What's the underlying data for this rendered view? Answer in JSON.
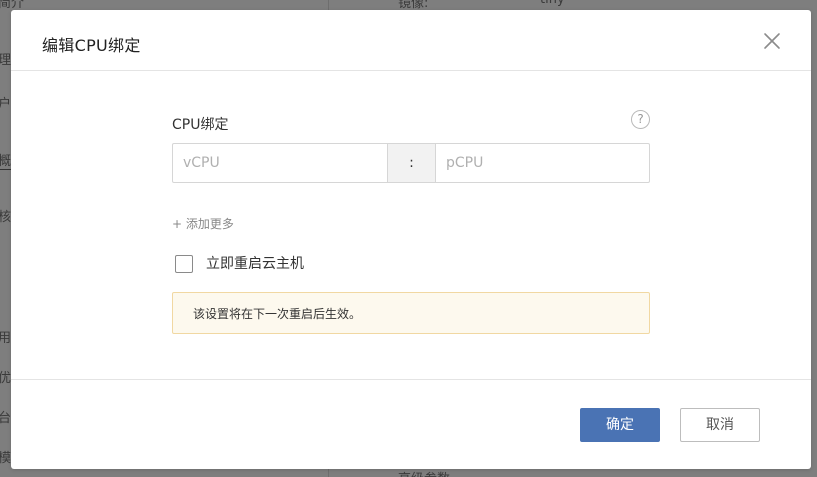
{
  "background": {
    "top_left": "简介",
    "top_right_label": "镜像:",
    "top_right_value": "tiny",
    "sidebar_items": [
      "理",
      "户",
      "概",
      "核",
      "用",
      "优",
      "台",
      "模"
    ],
    "bottom_label": "高级参数"
  },
  "dialog": {
    "title": "编辑CPU绑定",
    "close_icon": "close-icon",
    "field_label": "CPU绑定",
    "help_icon_glyph": "?",
    "vcpu_placeholder": "vCPU",
    "vcpu_value": "",
    "separator": ":",
    "pcpu_placeholder": "pCPU",
    "pcpu_value": "",
    "add_more": "+ 添加更多",
    "reboot_checkbox_label": "立即重启云主机",
    "reboot_checked": false,
    "notice": "该设置将在下一次重启后生效。",
    "confirm_label": "确定",
    "cancel_label": "取消"
  },
  "colors": {
    "primary": "#4a73b4",
    "notice_bg": "#fdf9ee",
    "notice_border": "#f1d8a2",
    "overlay": "#7f7f7f"
  }
}
